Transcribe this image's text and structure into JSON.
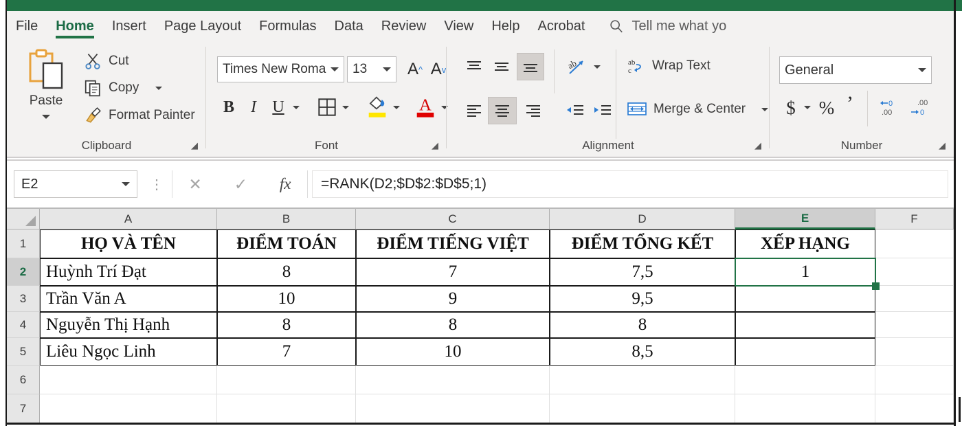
{
  "app": {
    "theme_color": "#217346",
    "title_bar_color": "#217346"
  },
  "ribbon": {
    "tabs": [
      {
        "label": "File",
        "active": false
      },
      {
        "label": "Home",
        "active": true
      },
      {
        "label": "Insert",
        "active": false
      },
      {
        "label": "Page Layout",
        "active": false
      },
      {
        "label": "Formulas",
        "active": false
      },
      {
        "label": "Data",
        "active": false
      },
      {
        "label": "Review",
        "active": false
      },
      {
        "label": "View",
        "active": false
      },
      {
        "label": "Help",
        "active": false
      },
      {
        "label": "Acrobat",
        "active": false
      }
    ],
    "tell_me": "Tell me what yo",
    "groups": {
      "clipboard": {
        "label": "Clipboard",
        "paste": "Paste",
        "cut": "Cut",
        "copy": "Copy",
        "format_painter": "Format Painter"
      },
      "font": {
        "label": "Font",
        "font_name": "Times New Roma",
        "font_size": "13",
        "bold": "B",
        "italic": "I",
        "underline": "U",
        "grow_font": "A",
        "shrink_font": "A",
        "fill_color": "#ffe600",
        "font_color": "#e00000"
      },
      "alignment": {
        "label": "Alignment",
        "wrap_text": "Wrap Text",
        "merge_center": "Merge & Center"
      },
      "number": {
        "label": "Number",
        "format": "General",
        "currency": "$",
        "percent": "%",
        "comma": "’"
      }
    }
  },
  "formula_bar": {
    "name_box": "E2",
    "cancel": "✕",
    "enter": "✓",
    "fx": "fx",
    "formula": "=RANK(D2;$D$2:$D$5;1)"
  },
  "sheet": {
    "columns": [
      {
        "label": "A",
        "selected": false
      },
      {
        "label": "B",
        "selected": false
      },
      {
        "label": "C",
        "selected": false
      },
      {
        "label": "D",
        "selected": false
      },
      {
        "label": "E",
        "selected": true
      },
      {
        "label": "F",
        "selected": false
      }
    ],
    "rows": [
      {
        "label": "1",
        "selected": false
      },
      {
        "label": "2",
        "selected": true
      },
      {
        "label": "3",
        "selected": false
      },
      {
        "label": "4",
        "selected": false
      },
      {
        "label": "5",
        "selected": false
      },
      {
        "label": "6",
        "selected": false
      },
      {
        "label": "7",
        "selected": false
      }
    ],
    "active_cell": "E2",
    "table": {
      "headers": [
        "HỌ VÀ TÊN",
        "ĐIỂM TOÁN",
        "ĐIỂM TIẾNG VIỆT",
        "ĐIỂM TỔNG KẾT",
        "XẾP HẠNG"
      ],
      "data": [
        [
          "Huỳnh Trí Đạt",
          "8",
          "7",
          "7,5",
          "1"
        ],
        [
          "Trần Văn A",
          "10",
          "9",
          "9,5",
          ""
        ],
        [
          "Nguyễn Thị Hạnh",
          "8",
          "8",
          "8",
          ""
        ],
        [
          "Liêu Ngọc Linh",
          "7",
          "10",
          "8,5",
          ""
        ]
      ]
    }
  }
}
